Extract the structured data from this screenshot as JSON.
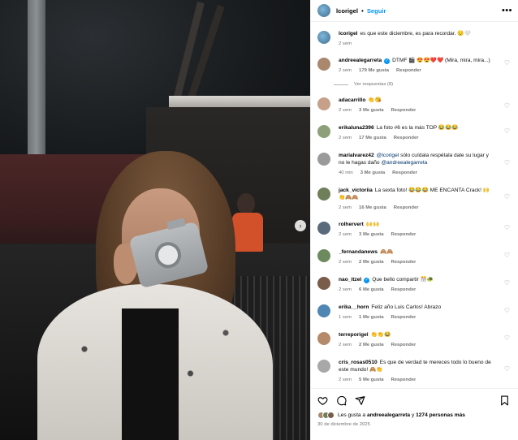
{
  "header": {
    "username": "lcorigel",
    "separator": "•",
    "follow_label": "Seguir",
    "more_icon": "more-horizontal-icon"
  },
  "caption": {
    "username": "lcorigel",
    "text": "es que este diciembre, es para recordar. 😔🤍",
    "time": "2 sem"
  },
  "comments": [
    {
      "username": "andreealegarreta",
      "verified": true,
      "text": "DTMF 🎬 😍😍❤️❤️ (Mira, mira, mira...)",
      "time": "2 sem",
      "likes": "179 Me gusta",
      "reply": "Responder"
    },
    {
      "username": "adacarrillo",
      "verified": false,
      "text": "👏😘",
      "time": "2 sem",
      "likes": "3 Me gusta",
      "reply": "Responder"
    },
    {
      "username": "erikaluna2396",
      "verified": false,
      "text": "La foto #6 es la más TOP 😂😂😂",
      "time": "2 sem",
      "likes": "17 Me gusta",
      "reply": "Responder"
    },
    {
      "username": "marialvarez42",
      "verified": false,
      "text_parts": [
        "@lcorigel",
        " sólo cuídala respétala dale su lugar y no le hagas daño ",
        "@andreealegarreta"
      ],
      "time": "40 min",
      "likes": "3 Me gusta",
      "reply": "Responder"
    },
    {
      "username": "jack_victoriia",
      "verified": false,
      "text": "La sexta foto! 😂😂😂 ME ENCANTA Crack! 🙌👏🙈🙈",
      "time": "2 sem",
      "likes": "16 Me gusta",
      "reply": "Responder"
    },
    {
      "username": "rolhervert",
      "verified": false,
      "text": "🙌🙌",
      "time": "2 sem",
      "likes": "3 Me gusta",
      "reply": "Responder"
    },
    {
      "username": "_fernandanews",
      "verified": false,
      "text": "🙈🙈",
      "time": "2 sem",
      "likes": "2 Me gusta",
      "reply": "Responder"
    },
    {
      "username": "nao_itzel",
      "verified": true,
      "text": "Que bello compartir 🎊🐢",
      "time": "2 sem",
      "likes": "6 Me gusta",
      "reply": "Responder"
    },
    {
      "username": "erika__horn",
      "verified": false,
      "text": "Feliz año Luis Carlos! Abrazo",
      "time": "1 sem",
      "likes": "1 Me gusta",
      "reply": "Responder"
    },
    {
      "username": "terreporigel",
      "verified": false,
      "text": "👏👏😂",
      "time": "2 sem",
      "likes": "2 Me gusta",
      "reply": "Responder"
    },
    {
      "username": "cris_rosas0510",
      "verified": false,
      "text": "Es que de verdad te mereces todo lo bueno de este mundo! 🙈👏",
      "time": "2 sem",
      "likes": "5 Me gusta",
      "reply": "Responder"
    }
  ],
  "view_replies": "Ver respuestas (8)",
  "actions": {
    "like_icon": "heart-icon",
    "comment_icon": "comment-icon",
    "share_icon": "send-icon",
    "save_icon": "bookmark-icon"
  },
  "likes": {
    "prefix": "Les gusta a",
    "user": "andreealegarreta",
    "connector": "y",
    "others": "1274 personas más"
  },
  "date": "30 de diciembre de 2025",
  "media": {
    "next_icon": "chevron-right-icon",
    "next_glyph": "›"
  },
  "colors": {
    "accent": "#0095f6",
    "muted": "#737373"
  }
}
